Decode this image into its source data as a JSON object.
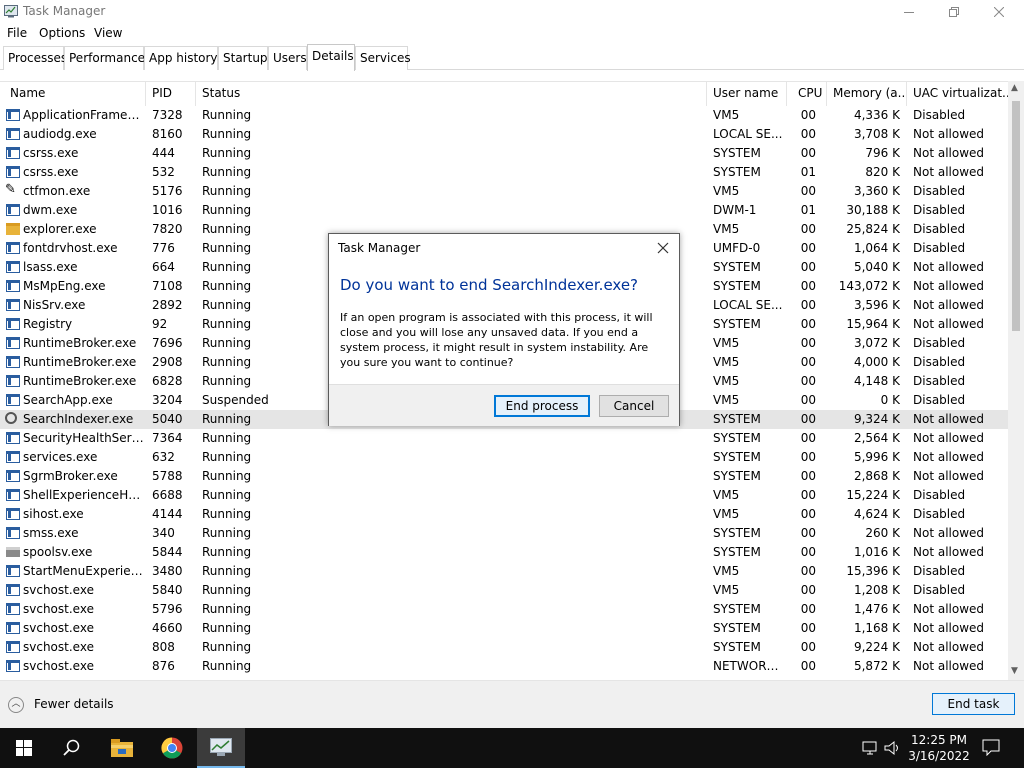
{
  "window": {
    "title": "Task Manager",
    "menu": [
      "File",
      "Options",
      "View"
    ]
  },
  "tabs": [
    {
      "label": "Processes"
    },
    {
      "label": "Performance"
    },
    {
      "label": "App history"
    },
    {
      "label": "Startup"
    },
    {
      "label": "Users"
    },
    {
      "label": "Details",
      "active": true
    },
    {
      "label": "Services"
    }
  ],
  "columns": {
    "name": "Name",
    "pid": "PID",
    "status": "Status",
    "user": "User name",
    "cpu": "CPU",
    "memory": "Memory (a...",
    "uac": "UAC virtualizat..."
  },
  "rows": [
    {
      "name": "ApplicationFrameHo...",
      "pid": "7328",
      "status": "Running",
      "user": "VM5",
      "cpu": "00",
      "memory": "4,336 K",
      "uac": "Disabled",
      "icon": "window-icon"
    },
    {
      "name": "audiodg.exe",
      "pid": "8160",
      "status": "Running",
      "user": "LOCAL SE...",
      "cpu": "00",
      "memory": "3,708 K",
      "uac": "Not allowed",
      "icon": "window-icon"
    },
    {
      "name": "csrss.exe",
      "pid": "444",
      "status": "Running",
      "user": "SYSTEM",
      "cpu": "00",
      "memory": "796 K",
      "uac": "Not allowed",
      "icon": "window-icon"
    },
    {
      "name": "csrss.exe",
      "pid": "532",
      "status": "Running",
      "user": "SYSTEM",
      "cpu": "01",
      "memory": "820 K",
      "uac": "Not allowed",
      "icon": "window-icon"
    },
    {
      "name": "ctfmon.exe",
      "pid": "5176",
      "status": "Running",
      "user": "VM5",
      "cpu": "00",
      "memory": "3,360 K",
      "uac": "Disabled",
      "icon": "pen-icon"
    },
    {
      "name": "dwm.exe",
      "pid": "1016",
      "status": "Running",
      "user": "DWM-1",
      "cpu": "01",
      "memory": "30,188 K",
      "uac": "Disabled",
      "icon": "window-icon"
    },
    {
      "name": "explorer.exe",
      "pid": "7820",
      "status": "Running",
      "user": "VM5",
      "cpu": "00",
      "memory": "25,824 K",
      "uac": "Disabled",
      "icon": "folder-icon"
    },
    {
      "name": "fontdrvhost.exe",
      "pid": "776",
      "status": "Running",
      "user": "UMFD-0",
      "cpu": "00",
      "memory": "1,064 K",
      "uac": "Disabled",
      "icon": "window-icon"
    },
    {
      "name": "lsass.exe",
      "pid": "664",
      "status": "Running",
      "user": "SYSTEM",
      "cpu": "00",
      "memory": "5,040 K",
      "uac": "Not allowed",
      "icon": "window-icon"
    },
    {
      "name": "MsMpEng.exe",
      "pid": "7108",
      "status": "Running",
      "user": "SYSTEM",
      "cpu": "00",
      "memory": "143,072 K",
      "uac": "Not allowed",
      "icon": "window-icon"
    },
    {
      "name": "NisSrv.exe",
      "pid": "2892",
      "status": "Running",
      "user": "LOCAL SE...",
      "cpu": "00",
      "memory": "3,596 K",
      "uac": "Not allowed",
      "icon": "window-icon"
    },
    {
      "name": "Registry",
      "pid": "92",
      "status": "Running",
      "user": "SYSTEM",
      "cpu": "00",
      "memory": "15,964 K",
      "uac": "Not allowed",
      "icon": "window-icon"
    },
    {
      "name": "RuntimeBroker.exe",
      "pid": "7696",
      "status": "Running",
      "user": "VM5",
      "cpu": "00",
      "memory": "3,072 K",
      "uac": "Disabled",
      "icon": "window-icon"
    },
    {
      "name": "RuntimeBroker.exe",
      "pid": "2908",
      "status": "Running",
      "user": "VM5",
      "cpu": "00",
      "memory": "4,000 K",
      "uac": "Disabled",
      "icon": "window-icon"
    },
    {
      "name": "RuntimeBroker.exe",
      "pid": "6828",
      "status": "Running",
      "user": "VM5",
      "cpu": "00",
      "memory": "4,148 K",
      "uac": "Disabled",
      "icon": "window-icon"
    },
    {
      "name": "SearchApp.exe",
      "pid": "3204",
      "status": "Suspended",
      "user": "VM5",
      "cpu": "00",
      "memory": "0 K",
      "uac": "Disabled",
      "icon": "window-icon"
    },
    {
      "name": "SearchIndexer.exe",
      "pid": "5040",
      "status": "Running",
      "user": "SYSTEM",
      "cpu": "00",
      "memory": "9,324 K",
      "uac": "Not allowed",
      "icon": "search-indexer-icon",
      "selected": true
    },
    {
      "name": "SecurityHealthServic...",
      "pid": "7364",
      "status": "Running",
      "user": "SYSTEM",
      "cpu": "00",
      "memory": "2,564 K",
      "uac": "Not allowed",
      "icon": "window-icon"
    },
    {
      "name": "services.exe",
      "pid": "632",
      "status": "Running",
      "user": "SYSTEM",
      "cpu": "00",
      "memory": "5,996 K",
      "uac": "Not allowed",
      "icon": "window-icon"
    },
    {
      "name": "SgrmBroker.exe",
      "pid": "5788",
      "status": "Running",
      "user": "SYSTEM",
      "cpu": "00",
      "memory": "2,868 K",
      "uac": "Not allowed",
      "icon": "window-icon"
    },
    {
      "name": "ShellExperienceHost....",
      "pid": "6688",
      "status": "Running",
      "user": "VM5",
      "cpu": "00",
      "memory": "15,224 K",
      "uac": "Disabled",
      "icon": "window-icon"
    },
    {
      "name": "sihost.exe",
      "pid": "4144",
      "status": "Running",
      "user": "VM5",
      "cpu": "00",
      "memory": "4,624 K",
      "uac": "Disabled",
      "icon": "window-icon"
    },
    {
      "name": "smss.exe",
      "pid": "340",
      "status": "Running",
      "user": "SYSTEM",
      "cpu": "00",
      "memory": "260 K",
      "uac": "Not allowed",
      "icon": "window-icon"
    },
    {
      "name": "spoolsv.exe",
      "pid": "5844",
      "status": "Running",
      "user": "SYSTEM",
      "cpu": "00",
      "memory": "1,016 K",
      "uac": "Not allowed",
      "icon": "printer-icon"
    },
    {
      "name": "StartMenuExperienc...",
      "pid": "3480",
      "status": "Running",
      "user": "VM5",
      "cpu": "00",
      "memory": "15,396 K",
      "uac": "Disabled",
      "icon": "window-icon"
    },
    {
      "name": "svchost.exe",
      "pid": "5840",
      "status": "Running",
      "user": "VM5",
      "cpu": "00",
      "memory": "1,208 K",
      "uac": "Disabled",
      "icon": "window-icon"
    },
    {
      "name": "svchost.exe",
      "pid": "5796",
      "status": "Running",
      "user": "SYSTEM",
      "cpu": "00",
      "memory": "1,476 K",
      "uac": "Not allowed",
      "icon": "window-icon"
    },
    {
      "name": "svchost.exe",
      "pid": "4660",
      "status": "Running",
      "user": "SYSTEM",
      "cpu": "00",
      "memory": "1,168 K",
      "uac": "Not allowed",
      "icon": "window-icon"
    },
    {
      "name": "svchost.exe",
      "pid": "808",
      "status": "Running",
      "user": "SYSTEM",
      "cpu": "00",
      "memory": "9,224 K",
      "uac": "Not allowed",
      "icon": "window-icon"
    },
    {
      "name": "svchost.exe",
      "pid": "876",
      "status": "Running",
      "user": "NETWORK...",
      "cpu": "00",
      "memory": "5,872 K",
      "uac": "Not allowed",
      "icon": "window-icon"
    }
  ],
  "footer": {
    "fewer_details": "Fewer details",
    "end_task": "End task"
  },
  "dialog": {
    "title": "Task Manager",
    "heading": "Do you want to end SearchIndexer.exe?",
    "body": "If an open program is associated with this process, it will close and you will lose any unsaved data. If you end a system process, it might result in system instability. Are you sure you want to continue?",
    "end_process": "End process",
    "cancel": "Cancel"
  },
  "taskbar": {
    "time": "12:25 PM",
    "date": "3/16/2022",
    "apps": [
      "start-icon",
      "search-icon",
      "file-explorer-icon",
      "chrome-icon",
      "task-manager-icon"
    ]
  },
  "colors": {
    "accent": "#0078d7",
    "dialog_heading": "#003399",
    "selected_row": "#e5e5e5",
    "taskbar": "#101010"
  }
}
